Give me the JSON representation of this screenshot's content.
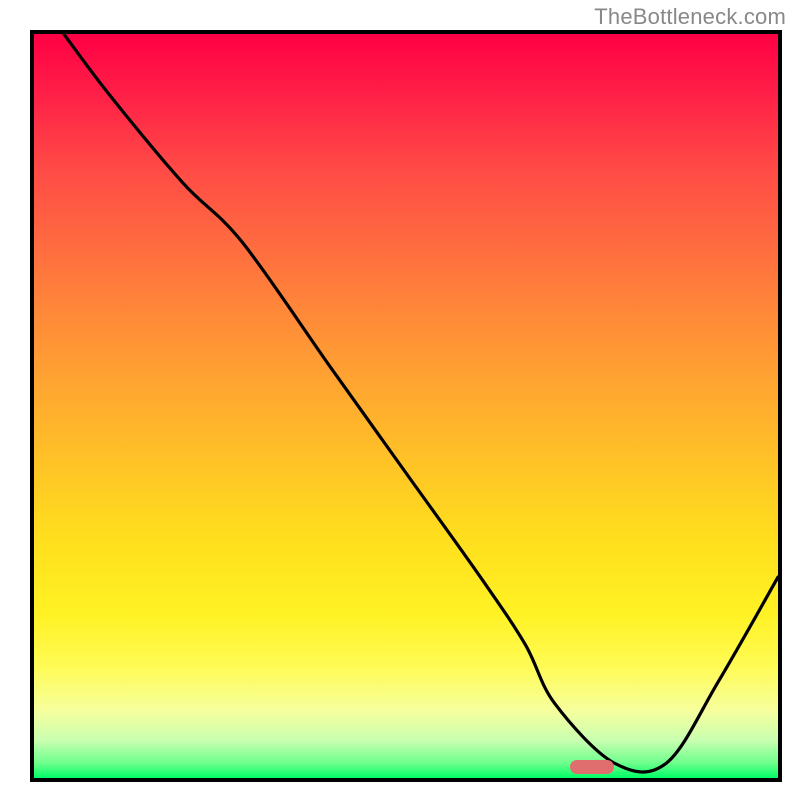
{
  "watermark": "TheBottleneck.com",
  "chart_data": {
    "type": "line",
    "title": "",
    "xlabel": "",
    "ylabel": "",
    "xlim": [
      0,
      100
    ],
    "ylim": [
      0,
      100
    ],
    "x": [
      4,
      10,
      20,
      28,
      40,
      50,
      60,
      66,
      70,
      78,
      85,
      92,
      100
    ],
    "y": [
      100,
      92,
      80,
      72,
      55,
      41,
      27,
      18,
      10,
      2,
      2,
      13,
      27
    ],
    "note": "y values are estimated from the curve position relative to full plot height; 0 = bottom (green), 100 = top (red)",
    "background_gradient": [
      "#ff0044",
      "#ffaa30",
      "#fff030",
      "#00ff66"
    ],
    "indicator": {
      "x": 75,
      "y": 1.5,
      "color": "#e06e6e"
    }
  }
}
